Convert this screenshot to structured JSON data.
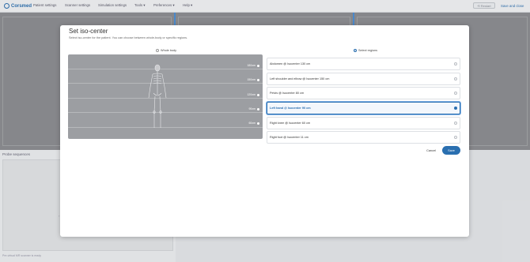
{
  "header": {
    "logo_text": "Corsmed",
    "nav": [
      "Patient settings",
      "Scanner settings",
      "Simulation settings",
      "Tools ▾",
      "Preferences ▾",
      "Help ▾"
    ],
    "restart_label": "Restart",
    "save_close_label": "Save and close"
  },
  "probe": {
    "title": "Probe sequences",
    "footer": "Pre-virtual MR scanner is ready"
  },
  "modal": {
    "title": "Set iso-center",
    "description": "Select iso-center for the patient. You can choose between whole-body or specific regions.",
    "radio_whole_body": "Whole body",
    "radio_select_regions": "Select regions",
    "height_markers": [
      "180cm",
      "150cm",
      "120cm",
      "90cm",
      "60cm"
    ],
    "regions": [
      {
        "label": "Abdomen @ Isocenter 130 cm",
        "selected": false
      },
      {
        "label": "Left shoulder and elbow @ Isocenter 150 cm",
        "selected": false
      },
      {
        "label": "Pelvis @ Isocenter 80 cm",
        "selected": false
      },
      {
        "label": "Left hand @ Isocenter 90 cm",
        "selected": true
      },
      {
        "label": "Right knee @ Isocenter 60 cm",
        "selected": false
      },
      {
        "label": "Right foot @ Isocenter 11 cm",
        "selected": false
      }
    ],
    "cancel_label": "Cancel",
    "save_label": "Save"
  },
  "colors": {
    "accent": "#2a6fb0"
  }
}
